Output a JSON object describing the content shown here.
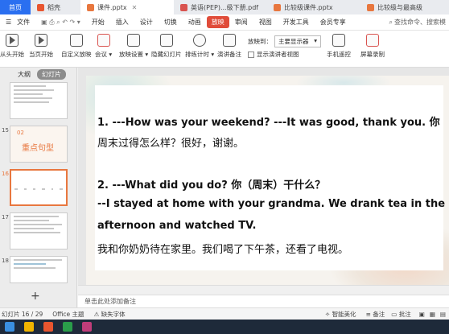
{
  "tabs": [
    {
      "label": "首页",
      "kind": "home"
    },
    {
      "label": "稻壳",
      "kind": "normal",
      "color": "#e8552f"
    },
    {
      "label": "课件.pptx",
      "kind": "active",
      "color": "#e8773f"
    },
    {
      "label": "英语(PEP)...级下册.pdf",
      "kind": "normal",
      "color": "#d9534f"
    },
    {
      "label": "比较级课件.pptx",
      "kind": "normal",
      "color": "#e8773f"
    },
    {
      "label": "比较级与最高级",
      "kind": "normal",
      "color": "#e8773f"
    }
  ],
  "menu": {
    "file": "文件",
    "items": [
      "开始",
      "插入",
      "设计",
      "切换",
      "动画",
      "放映",
      "审阅",
      "视图",
      "开发工具",
      "会员专享"
    ],
    "active": "放映",
    "search": "查找命令、搜索模"
  },
  "toolbar": {
    "from_start": "从头开始",
    "from_current": "当页开始",
    "custom": "自定义放映",
    "meeting": "会议",
    "setup": "放映设置",
    "hide": "隐藏幻灯片",
    "rehearse": "排练计时",
    "notes": "演讲备注",
    "monitor_label": "放映到：",
    "monitor_value": "主要显示器",
    "presenter_view": "显示演讲者视图",
    "remote": "手机遥控",
    "record": "屏幕录制"
  },
  "sidebar": {
    "tab_outline": "大纲",
    "tab_slides": "幻灯片",
    "thumbs": [
      {
        "num": "",
        "title": ""
      },
      {
        "num": "15",
        "title": "重点句型"
      },
      {
        "num": "16",
        "title": "",
        "selected": true
      },
      {
        "num": "17",
        "title": ""
      },
      {
        "num": "18",
        "title": ""
      }
    ],
    "thumb15_small": "02",
    "add": "+"
  },
  "slide": {
    "lines": [
      "1. ---How was your weekend? ---It was good, thank you. 你",
      "周末过得怎么样？很好，谢谢。",
      "2. ---What did you do? 你（周末）干什么？",
      "--I stayed at home with your grandma. We drank tea in the",
      "afternoon and watched TV.",
      "我和你奶奶待在家里。我们喝了下午茶，还看了电视。"
    ]
  },
  "notes_placeholder": "单击此处添加备注",
  "status": {
    "slide_count": "幻灯片 16 / 29",
    "theme": "Office 主题",
    "font_missing": "缺失字体",
    "beautify": "智能美化",
    "notes": "备注",
    "comments": "批注"
  },
  "colors": {
    "accent": "#e04c3a",
    "home_tab": "#2a6ff0",
    "selection": "#e8773f"
  }
}
